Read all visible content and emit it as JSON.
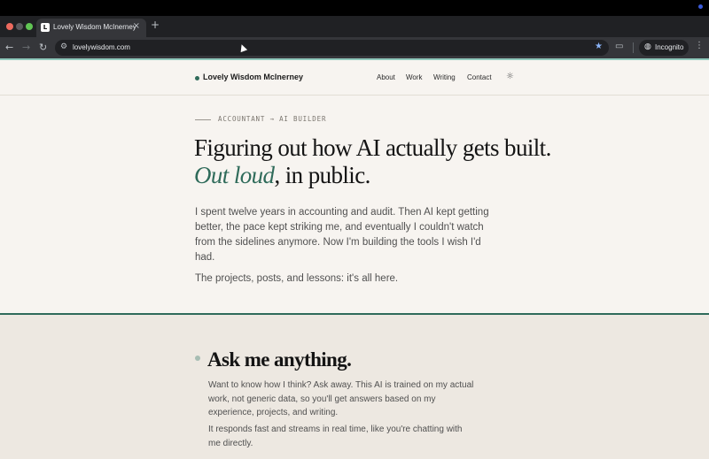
{
  "browser": {
    "tab_title": "Lovely Wisdom McInerney",
    "tab_favicon": "L",
    "url": "lovelywisdom.com",
    "incognito_label": "Incognito"
  },
  "site": {
    "brand": "Lovely Wisdom McInerney",
    "nav": [
      "About",
      "Work",
      "Writing",
      "Contact"
    ],
    "accent_color": "#2f6b5a"
  },
  "hero": {
    "eyebrow": "ACCOUNTANT → AI BUILDER",
    "title_line1": "Figuring out how AI actually gets built.",
    "title_accent": "Out loud",
    "title_line2_rest": ", in public.",
    "intro": "I spent twelve years in accounting and audit. Then AI kept getting better, the pace kept striking me, and eventually I couldn't watch from the sidelines anymore. Now I'm building the tools I wish I'd had.",
    "intro_2": "The projects, posts, and lessons: it's all here."
  },
  "ask": {
    "title": "Ask me anything.",
    "desc": "Want to know how I think? Ask away. This AI is trained on my actual work, not generic data, so you'll get answers based on my experience, projects, and writing.",
    "desc_2": "It responds fast and streams in real time, like you're chatting with me directly."
  }
}
